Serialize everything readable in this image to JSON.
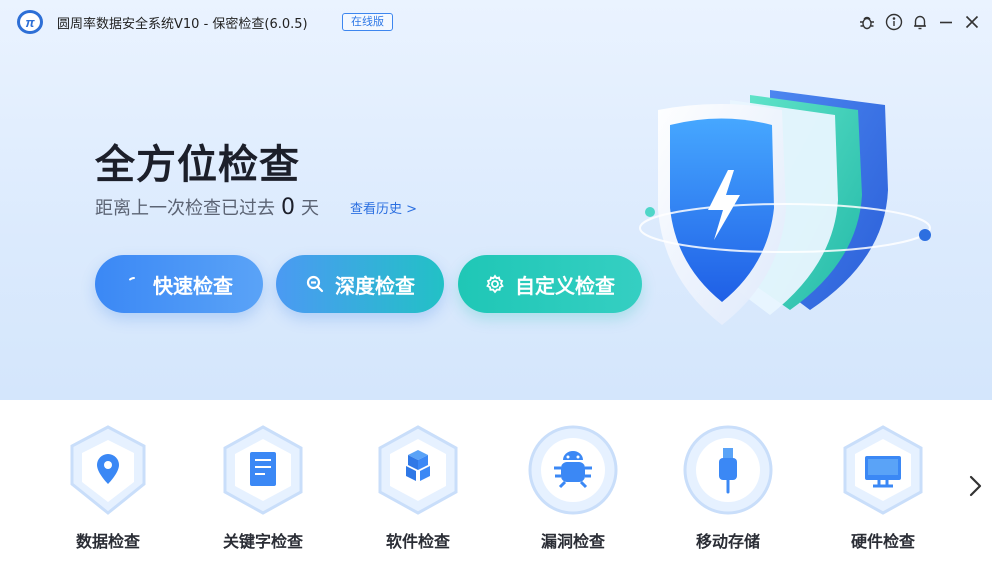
{
  "window": {
    "title": "圆周率数据安全系统V10 - 保密检查(6.0.5)",
    "edition_badge": "在线版",
    "icons": [
      "logo-icon",
      "bug-icon",
      "info-icon",
      "bell-icon",
      "minimize-icon",
      "close-icon"
    ]
  },
  "hero": {
    "title": "全方位检查",
    "since_prefix": "距离上一次检查已过去",
    "since_days": "0",
    "since_unit": "天",
    "history_link": "查看历史 >"
  },
  "scan_buttons": {
    "quick": "快速检查",
    "deep": "深度检查",
    "custom": "自定义检查"
  },
  "features": [
    {
      "label": "数据检查",
      "icon": "location-pin-icon"
    },
    {
      "label": "关键字检查",
      "icon": "document-icon"
    },
    {
      "label": "软件检查",
      "icon": "cubes-icon"
    },
    {
      "label": "漏洞检查",
      "icon": "bug-icon"
    },
    {
      "label": "移动存储",
      "icon": "usb-icon"
    },
    {
      "label": "硬件检查",
      "icon": "monitor-icon"
    }
  ],
  "colors": {
    "accent_blue": "#3b88f5",
    "accent_teal": "#1fc7b6",
    "hero_bg": "#dbeafd"
  }
}
